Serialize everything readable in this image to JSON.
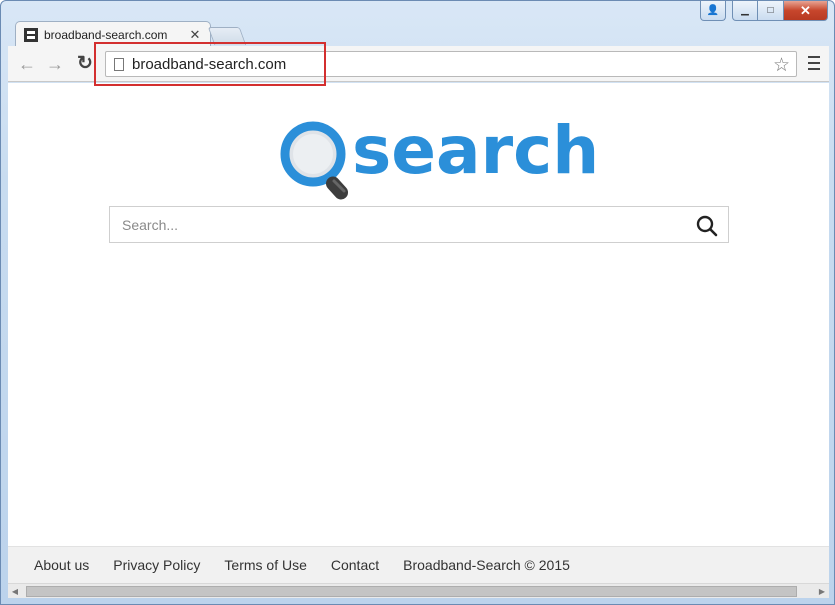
{
  "browser": {
    "tab": {
      "title": "broadband-search.com",
      "close_glyph": "✕"
    },
    "window_controls": {
      "user": "👤",
      "minimize": "▁",
      "maximize": "□",
      "close": "✕"
    },
    "toolbar": {
      "back_glyph": "←",
      "forward_glyph": "→",
      "reload_glyph": "↻",
      "url": "broadband-search.com",
      "star_glyph": "☆"
    }
  },
  "page": {
    "logo_text": "search",
    "search": {
      "placeholder": "Search...",
      "value": ""
    },
    "footer": {
      "links": [
        "About us",
        "Privacy Policy",
        "Terms of Use",
        "Contact"
      ],
      "copyright": "Broadband-Search © 2015"
    }
  },
  "colors": {
    "brand_blue": "#2b8fd9",
    "highlight_red": "#d32f2f"
  },
  "icons": {
    "favicon": "film-strip-icon",
    "page": "page-icon",
    "star": "star-icon",
    "menu": "hamburger-menu-icon",
    "search": "magnifier-icon"
  }
}
